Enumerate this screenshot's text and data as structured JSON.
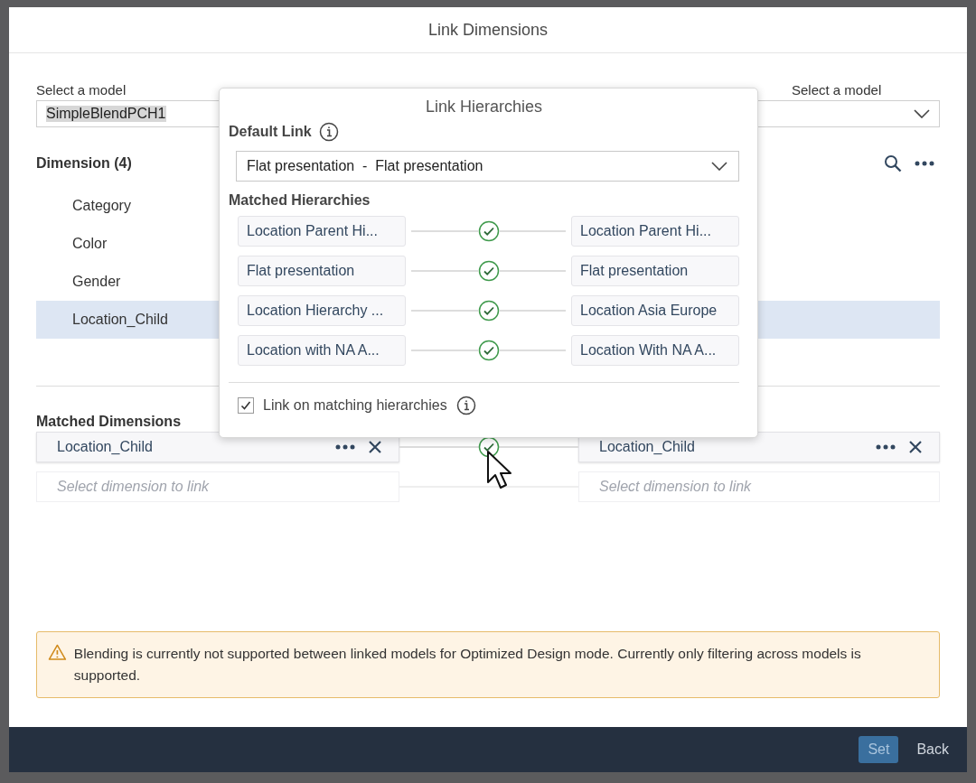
{
  "dialog": {
    "title": "Link Dimensions"
  },
  "left_model": {
    "label": "Select a model",
    "value": "SimpleBlendPCH1"
  },
  "right_model": {
    "label": "Select a model"
  },
  "dimensions": {
    "title": "Dimension",
    "count": "(4)",
    "items": [
      {
        "label": "Category",
        "selected": false
      },
      {
        "label": "Color",
        "selected": false
      },
      {
        "label": "Gender",
        "selected": false
      },
      {
        "label": "Location_Child",
        "selected": true
      }
    ]
  },
  "popover": {
    "title": "Link Hierarchies",
    "default_link": {
      "label": "Default Link",
      "value": "Flat presentation  -  Flat presentation"
    },
    "matched_title": "Matched Hierarchies",
    "pairs": [
      {
        "left": "Location Parent Hi...",
        "right": "Location Parent Hi...",
        "linked": true
      },
      {
        "left": "Flat presentation",
        "right": "Flat presentation",
        "linked": true
      },
      {
        "left": "Location Hierarchy ...",
        "right": "Location Asia Europe",
        "linked": true
      },
      {
        "left": "Location with NA A...",
        "right": "Location With NA A...",
        "linked": true
      }
    ],
    "link_matching": {
      "label": "Link on matching hierarchies",
      "checked": true
    }
  },
  "matched_dimensions": {
    "title": "Matched Dimensions",
    "rows": [
      {
        "kind": "linked",
        "left": "Location_Child",
        "right": "Location_Child"
      },
      {
        "kind": "empty",
        "left": "Select dimension to link",
        "right": "Select dimension to link"
      }
    ]
  },
  "warning": "Blending is currently not supported between linked models for Optimized Design mode. Currently only filtering across models is supported.",
  "buttons": [
    {
      "label": "Set",
      "kind": "primary"
    },
    {
      "label": "Back",
      "kind": "plain"
    }
  ]
}
